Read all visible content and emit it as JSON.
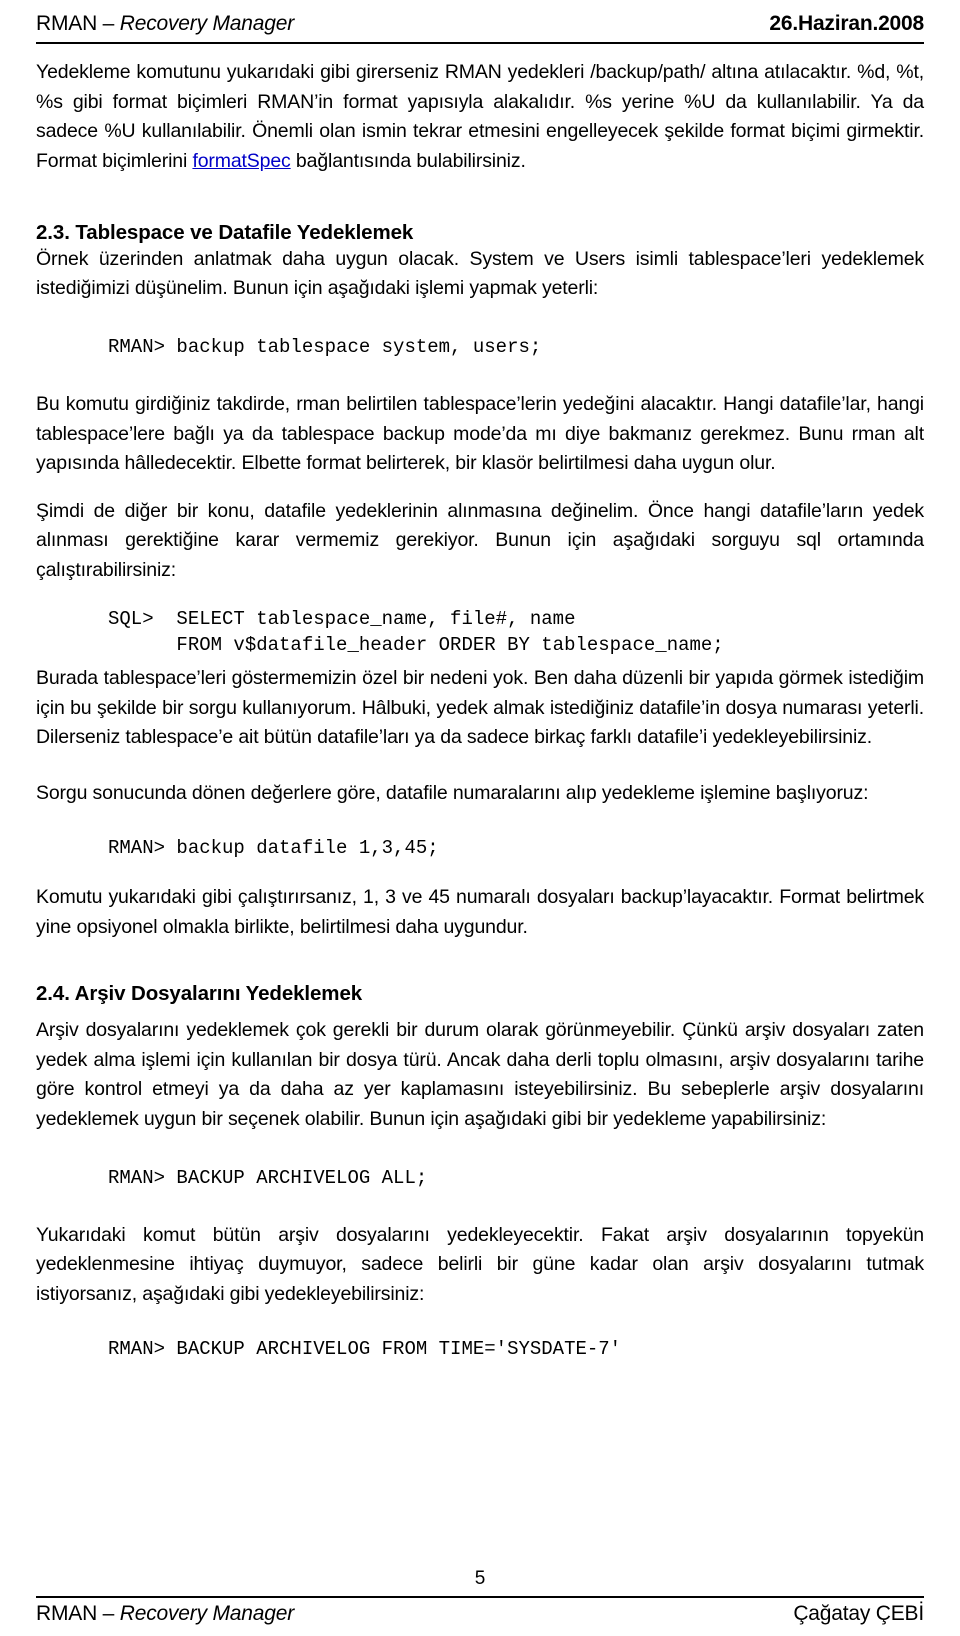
{
  "header": {
    "title_plain": "RMAN – ",
    "title_italic": "Recovery Manager",
    "date": "26.Haziran.2008"
  },
  "content": {
    "intro_part1": "Yedekleme komutunu yukarıdaki gibi girerseniz RMAN yedekleri /backup/path/ altına atılacaktır. %d, %t, %s gibi format biçimleri RMAN’in format yapısıyla alakalıdır. %s yerine %U da kullanılabilir. Ya da sadece %U kullanılabilir. Önemli olan ismin tekrar etmesini engelleyecek şekilde format biçimi girmektir. Format biçimlerini ",
    "intro_link": "formatSpec",
    "intro_part2": " bağlantısında bulabilirsiniz.",
    "section_23_title": "2.3. Tablespace ve Datafile Yedeklemek",
    "para_23_1": "Örnek üzerinden anlatmak daha uygun olacak. System ve Users isimli tablespace’leri yedeklemek istediğimizi düşünelim. Bunun için aşağıdaki işlemi yapmak yeterli:",
    "code_backup_tablespace": "RMAN> backup tablespace system, users;",
    "para_23_2": "Bu komutu girdiğiniz takdirde, rman belirtilen tablespace’lerin yedeğini alacaktır. Hangi datafile’lar, hangi tablespace’lere bağlı ya da tablespace backup mode’da mı diye bakmanız gerekmez. Bunu rman alt yapısında hâlledecektir. Elbette format belirterek, bir klasör belirtilmesi daha uygun olur.",
    "para_23_3": "Şimdi de diğer bir konu, datafile yedeklerinin alınmasına değinelim. Önce hangi datafile’ların yedek alınması gerektiğine karar vermemiz gerekiyor. Bunun için aşağıdaki sorguyu sql ortamında çalıştırabilirsiniz:",
    "code_sql": "SQL>  SELECT tablespace_name, file#, name\n      FROM v$datafile_header ORDER BY tablespace_name;",
    "para_23_4": "Burada tablespace’leri göstermemizin özel bir nedeni yok. Ben daha düzenli bir yapıda görmek istediğim için bu şekilde bir sorgu kullanıyorum. Hâlbuki, yedek almak istediğiniz datafile’in dosya numarası yeterli. Dilerseniz tablespace’e ait bütün datafile’ları ya da sadece birkaç farklı datafile’i yedekleyebilirsiniz.",
    "para_23_5": "Sorgu sonucunda dönen değerlere göre, datafile numaralarını alıp yedekleme işlemine başlıyoruz:",
    "code_backup_datafile": "RMAN> backup datafile 1,3,45;",
    "para_23_6": "Komutu yukarıdaki gibi çalıştırırsanız, 1, 3 ve 45 numaralı dosyaları backup’layacaktır. Format belirtmek yine opsiyonel olmakla birlikte, belirtilmesi daha uygundur.",
    "section_24_title": "2.4. Arşiv Dosyalarını Yedeklemek",
    "para_24_1": "Arşiv dosyalarını yedeklemek çok gerekli bir durum olarak görünmeyebilir. Çünkü arşiv dosyaları zaten yedek alma işlemi için kullanılan bir dosya türü. Ancak daha derli toplu olmasını, arşiv dosyalarını tarihe göre kontrol etmeyi ya da daha az yer kaplamasını isteyebilirsiniz. Bu sebeplerle arşiv dosyalarını yedeklemek uygun bir seçenek olabilir. Bunun için aşağıdaki gibi bir yedekleme yapabilirsiniz:",
    "code_archivelog_all": "RMAN> BACKUP ARCHIVELOG ALL;",
    "para_24_2": "Yukarıdaki komut bütün arşiv dosyalarını yedekleyecektir. Fakat arşiv dosyalarının topyekün yedeklenmesine ihtiyaç duymuyor, sadece belirli bir güne kadar  olan arşiv dosyalarını tutmak istiyorsanız, aşağıdaki gibi yedekleyebilirsiniz:",
    "code_archivelog_time": "RMAN> BACKUP ARCHIVELOG FROM TIME='SYSDATE-7'"
  },
  "footer": {
    "page_number": "5",
    "title_plain": "RMAN – ",
    "title_italic": "Recovery Manager",
    "author": "Çağatay ÇEBİ"
  }
}
